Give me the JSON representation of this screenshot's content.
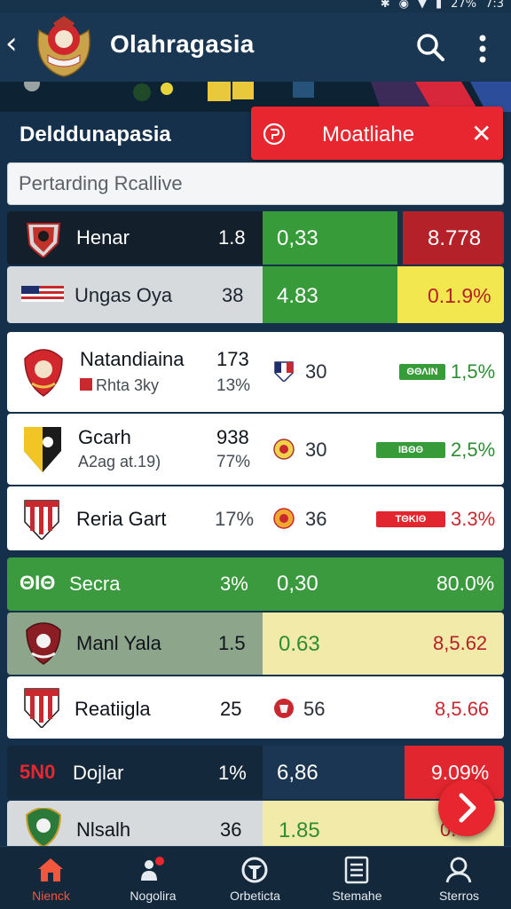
{
  "status_bar": {
    "bluetooth_icon": "bluetooth-icon",
    "battery": "27%",
    "time": "7:3"
  },
  "header": {
    "title": "Olahragasia"
  },
  "section": {
    "title": "Delddunapasia"
  },
  "promo": {
    "label": "Moatliahe"
  },
  "search": {
    "placeholder": "Pertarding Rcallive"
  },
  "rows": [
    {
      "name": "Henar",
      "val1": "1.8",
      "mid": "0,33",
      "right": "8.778"
    },
    {
      "name": "Ungas Oya",
      "val1": "38",
      "mid": "4.83",
      "right": "0.1.9%"
    },
    {
      "name": "Natandiaina",
      "sub": "Rhta 3ky",
      "val1": "173",
      "val2": "13%",
      "mid": "30",
      "badge": "ΘΘΛΙΝ",
      "right": "1,5%"
    },
    {
      "name": "Gcarh",
      "sub": "A2ag at.19)",
      "val1": "938",
      "val2": "77%",
      "mid": "30",
      "badge": "ΙΒΘΘ",
      "right": "2,5%"
    },
    {
      "name": "Reria Gart",
      "val1": "17%",
      "mid": "36",
      "badge": "ΤΘΚΙΘ",
      "right": "3.3%"
    },
    {
      "name": "Secra",
      "prefix": "ΘΙΘ",
      "val1": "3%",
      "mid": "0,30",
      "right": "80.0%"
    },
    {
      "name": "Manl Yala",
      "val1": "1.5",
      "mid": "0.63",
      "right": "8,5.62"
    },
    {
      "name": "Reatiigla",
      "val1": "25",
      "mid": "56",
      "right": "8,5.66"
    },
    {
      "name": "Dojlar",
      "prefix": "5N0",
      "val1": "1%",
      "mid": "6,86",
      "right": "9.09%"
    },
    {
      "name": "Nlsalh",
      "val1": "36",
      "mid": "1.85",
      "right": "0."
    }
  ],
  "nav": [
    {
      "label": "Nienck",
      "icon": "home-icon"
    },
    {
      "label": "Nogolira",
      "icon": "people-icon"
    },
    {
      "label": "Orbeticta",
      "icon": "shield-icon"
    },
    {
      "label": "Stemahe",
      "icon": "list-icon"
    },
    {
      "label": "Sterros",
      "icon": "user-icon"
    }
  ],
  "colors": {
    "accent_red": "#e8262f",
    "green": "#3a9a3d",
    "yellow": "#f3e74f",
    "navy": "#15304a"
  }
}
